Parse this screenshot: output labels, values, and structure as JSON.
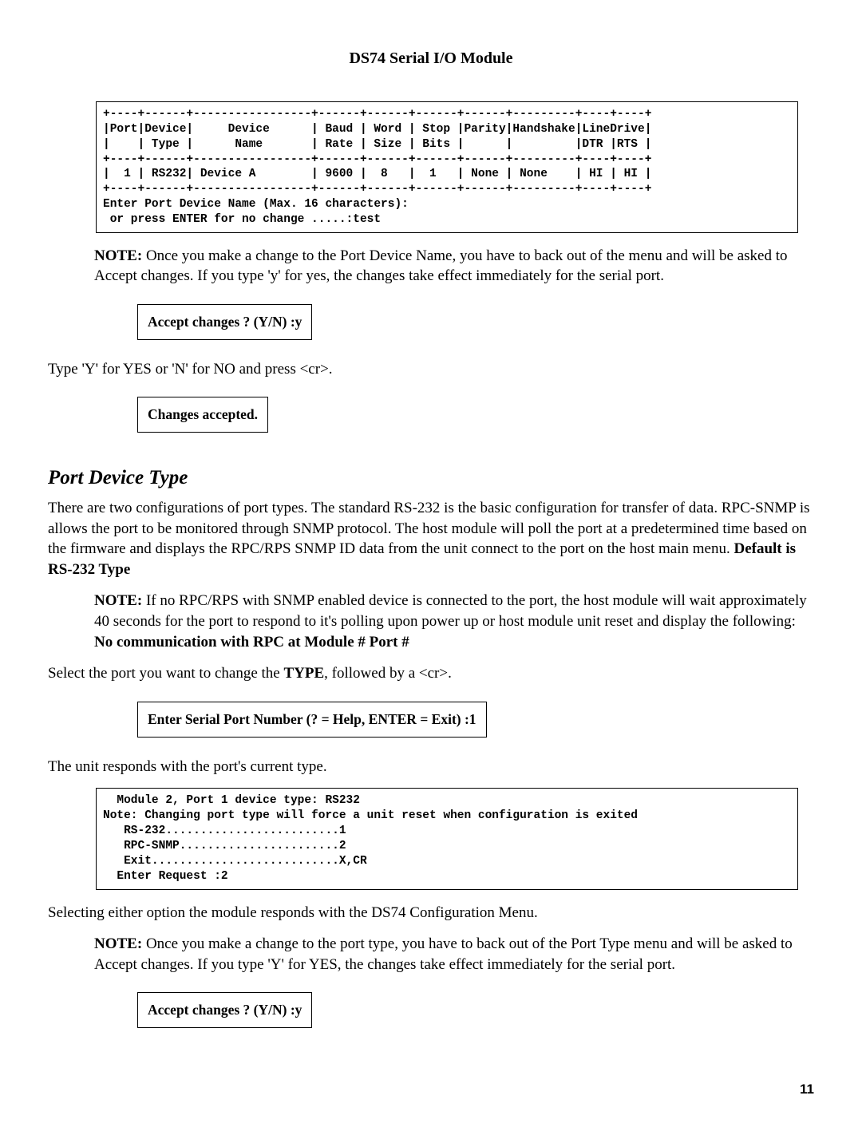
{
  "header": {
    "title": "DS74 Serial I/O Module"
  },
  "box1_text": "+----+------+-----------------+------+------+------+------+---------+----+----+\n|Port|Device|     Device      | Baud | Word | Stop |Parity|Handshake|LineDrive|\n|    | Type |      Name       | Rate | Size | Bits |      |         |DTR |RTS |\n+----+------+-----------------+------+------+------+------+---------+----+----+\n|  1 | RS232| Device A        | 9600 |  8   |  1   | None | None    | HI | HI |\n+----+------+-----------------+------+------+------+------+---------+----+----+\nEnter Port Device Name (Max. 16 characters):\n or press ENTER for no change .....:test",
  "note1": {
    "label": "NOTE:",
    "text": " Once you make a change to the Port Device Name, you have to back out of the menu and will be asked to Accept changes. If you type 'y' for yes, the changes take effect immediately for the serial port."
  },
  "box2_text": "Accept changes ? (Y/N) :y",
  "para1": "Type 'Y' for YES or 'N' for NO and press <cr>.",
  "box3_text": "Changes accepted.",
  "section_heading": "Port Device Type",
  "para2": {
    "text": "There are two configurations of port types. The standard RS-232 is the basic configuration for transfer of data.  RPC-SNMP is allows the port to be monitored through SNMP protocol. The host module will poll the port at a predetermined time based on the firmware and displays the RPC/RPS SNMP ID data from the unit connect to the port on the host main menu. ",
    "bold": "Default is RS-232 Type"
  },
  "note2": {
    "label": "NOTE:",
    "text1": " If no RPC/RPS with SNMP enabled device is connected to the port, the host module will wait approximately 40 seconds for the port to respond to it's polling upon power up or host module unit reset and display the following: ",
    "bold": "No communication with RPC at Module # Port #"
  },
  "para3": {
    "text1": "Select the port you want to change the ",
    "bold": "TYPE",
    "text2": ", followed by a <cr>."
  },
  "box4_text": "Enter Serial Port Number (? =  Help, ENTER =  Exit) :1",
  "para4": "The unit responds with the port's current type.",
  "box5_text": "  Module 2, Port 1 device type: RS232\nNote: Changing port type will force a unit reset when configuration is exited\n   RS-232.........................1\n   RPC-SNMP.......................2\n   Exit...........................X,CR\n  Enter Request :2",
  "para5": "Selecting either option the module responds with the DS74 Configuration Menu.",
  "note3": {
    "label": "NOTE:",
    "text": " Once you make a change to the port type, you have to back out of the Port Type menu and will be asked to Accept changes. If you type 'Y' for YES, the changes take effect immediately for the serial port."
  },
  "box6_text": "Accept changes ? (Y/N) :y",
  "page_number": "11"
}
